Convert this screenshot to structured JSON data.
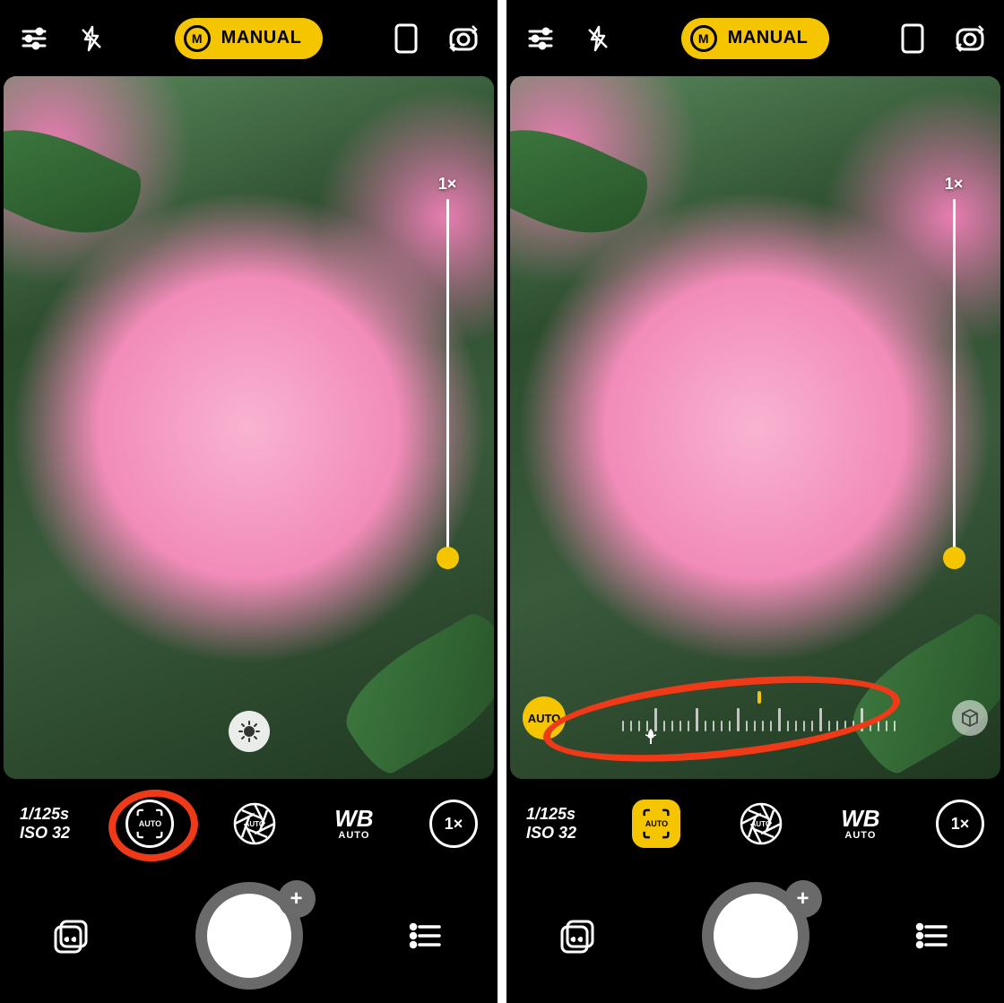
{
  "left": {
    "mode": {
      "badge": "M",
      "label": "MANUAL"
    },
    "zoom_label": "1×",
    "exposure": {
      "shutter": "1/125s",
      "iso": "ISO 32"
    },
    "controls": {
      "focus_label": "AUTO",
      "aperture_label": "AUTO",
      "wb_main": "WB",
      "wb_sub": "AUTO",
      "zoom_pill": "1×"
    },
    "highlight": "focus-control",
    "shutter_plus": "+"
  },
  "right": {
    "mode": {
      "badge": "M",
      "label": "MANUAL"
    },
    "zoom_label": "1×",
    "exposure": {
      "shutter": "1/125s",
      "iso": "ISO 32"
    },
    "controls": {
      "focus_label": "AUTO",
      "aperture_label": "AUTO",
      "wb_main": "WB",
      "wb_sub": "AUTO",
      "zoom_pill": "1×"
    },
    "focus_overlay": {
      "auto_chip": "AUTO"
    },
    "highlight": "focus-scale",
    "shutter_plus": "+"
  }
}
